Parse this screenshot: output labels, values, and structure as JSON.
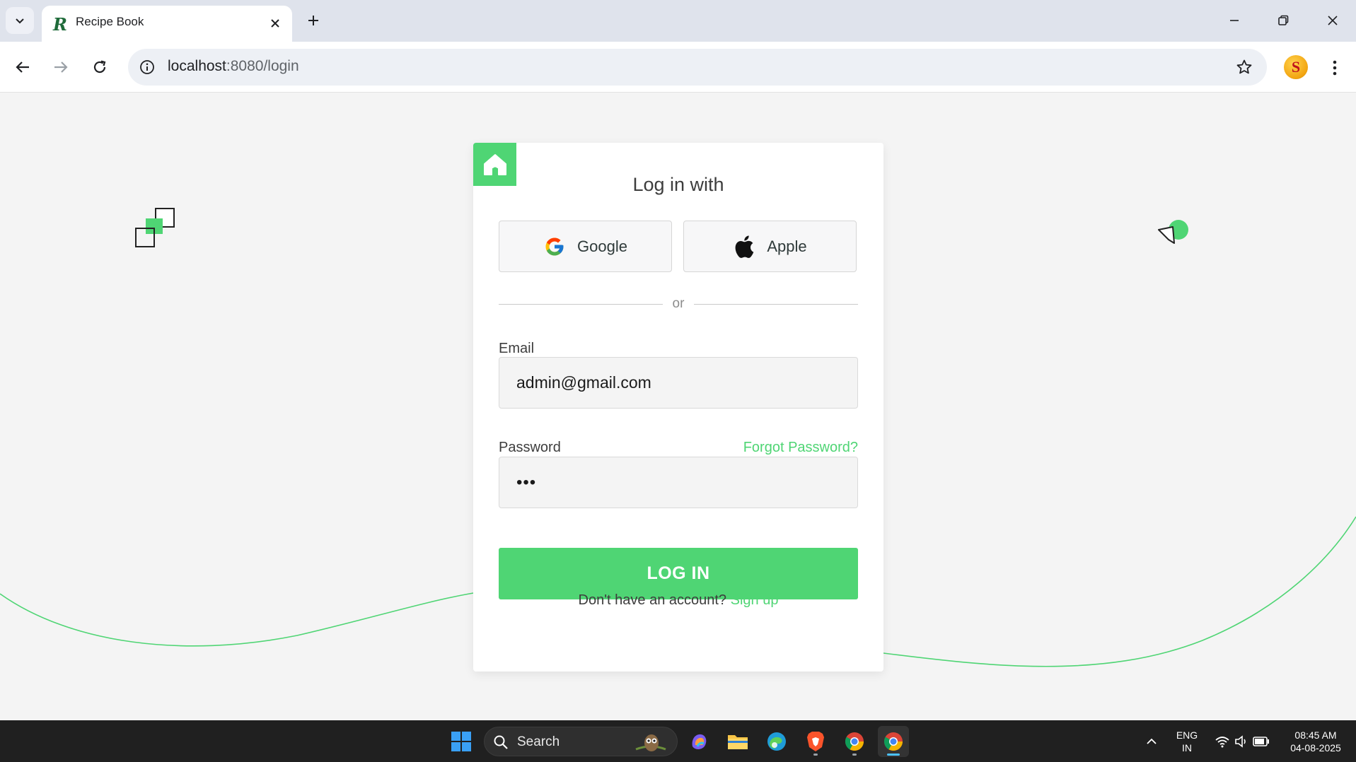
{
  "browser": {
    "tab_title": "Recipe Book",
    "favicon_letter": "R",
    "url_host": "localhost",
    "url_rest": ":8080/login"
  },
  "profile_initial": "S",
  "login": {
    "heading": "Log in with",
    "google_label": "Google",
    "apple_label": "Apple",
    "divider": "or",
    "email_label": "Email",
    "email_value": "admin@gmail.com",
    "password_label": "Password",
    "forgot_label": "Forgot Password?",
    "password_mask": "•••",
    "submit_label": "LOG IN",
    "signup_prompt": "Don't have an account?",
    "signup_link": "Sign up"
  },
  "taskbar": {
    "search_placeholder": "Search",
    "lang_line1": "ENG",
    "lang_line2": "IN",
    "time": "08:45 AM",
    "date": "04-08-2025"
  },
  "colors": {
    "accent": "#4fd574",
    "taskbar": "#202020"
  }
}
